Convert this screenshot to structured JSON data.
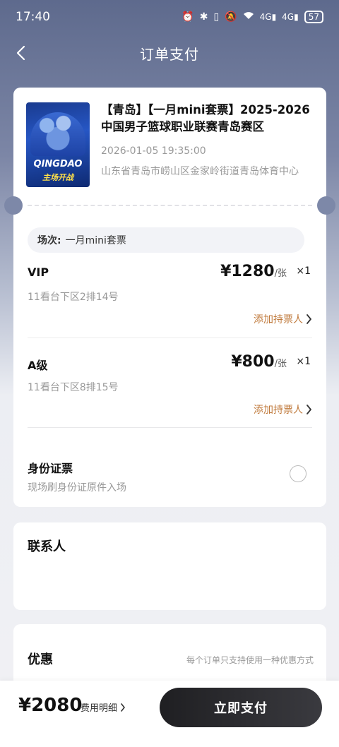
{
  "status_bar": {
    "time": "17:40",
    "icons": [
      "alarm-icon",
      "bluetooth-icon",
      "vibrate-icon",
      "mute-icon",
      "wifi-icon",
      "4g-signal-icon",
      "4g-signal-icon"
    ],
    "signal_label_1": "4G",
    "signal_label_2": "4G",
    "battery": "57"
  },
  "nav": {
    "back_icon": "chevron-left-icon",
    "title": "订单支付"
  },
  "event": {
    "poster_city": "QINGDAO",
    "poster_slogan": "主场开战",
    "title": "【青岛】【一月mini套票】2025-2026中国男子篮球职业联赛青岛赛区",
    "datetime": "2026-01-05 19:35:00",
    "venue": "山东省青岛市崂山区金家岭街道青岛体育中心"
  },
  "session": {
    "label": "场次:",
    "value": "一月mini套票"
  },
  "tickets": [
    {
      "name": "VIP",
      "seat": "11看台下区2排14号",
      "price": "¥1280",
      "unit": "/张",
      "qty": "×1",
      "add_holder": "添加持票人"
    },
    {
      "name": "A级",
      "seat": "11看台下区8排15号",
      "price": "¥800",
      "unit": "/张",
      "qty": "×1",
      "add_holder": "添加持票人"
    }
  ],
  "id_ticket": {
    "title": "身份证票",
    "subtitle": "现场刷身份证原件入场",
    "selected": false
  },
  "contact": {
    "title": "联系人"
  },
  "discount": {
    "title": "优惠",
    "note": "每个订单只支持使用一种优惠方式"
  },
  "footer": {
    "total": "¥2080",
    "fee_detail": "费用明细",
    "pay_button": "立即支付"
  },
  "colors": {
    "accent_orange": "#c07a3c",
    "pay_button": "#1f1f22",
    "header_bg": "#5e6a8d"
  }
}
